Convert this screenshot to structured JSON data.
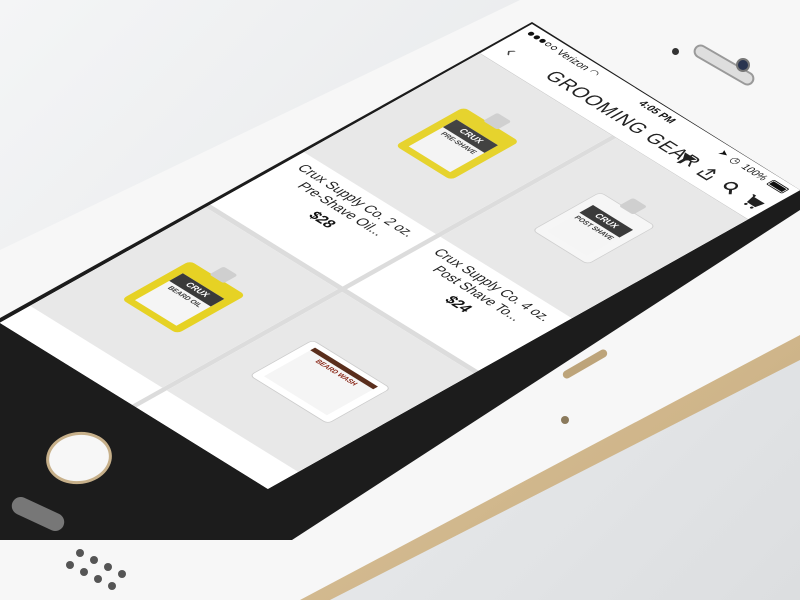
{
  "status_bar": {
    "carrier": "Verizon",
    "time": "4:05 PM",
    "battery": "100%"
  },
  "nav": {
    "title": "GROOMING GEAR",
    "icons": [
      "back-chevron-icon",
      "filter-icon",
      "share-icon",
      "search-icon",
      "cart-icon"
    ]
  },
  "products": [
    {
      "name": "Crux Supply Co. 2 oz. Pre-Shave Oil...",
      "price": "$28",
      "brand": "CRUX",
      "type": "PRE-SHAVE",
      "liquid": "#e6d224"
    },
    {
      "name": "Crux Supply Co. 4 oz. Post Shave To...",
      "price": "$24",
      "brand": "CRUX",
      "type": "POST SHAVE",
      "liquid": "#f2f2f2"
    },
    {
      "name": "",
      "price": "",
      "brand": "CRUX",
      "type": "BEARD OIL",
      "liquid": "#e6d224"
    },
    {
      "name": "",
      "price": "",
      "brand": "",
      "type": "BEARD WASH",
      "liquid": "#ffffff"
    }
  ],
  "colors": {
    "phone_frame": "#d8c3a0",
    "screen_bg": "#ffffff",
    "image_bg": "#e8e8e8"
  }
}
